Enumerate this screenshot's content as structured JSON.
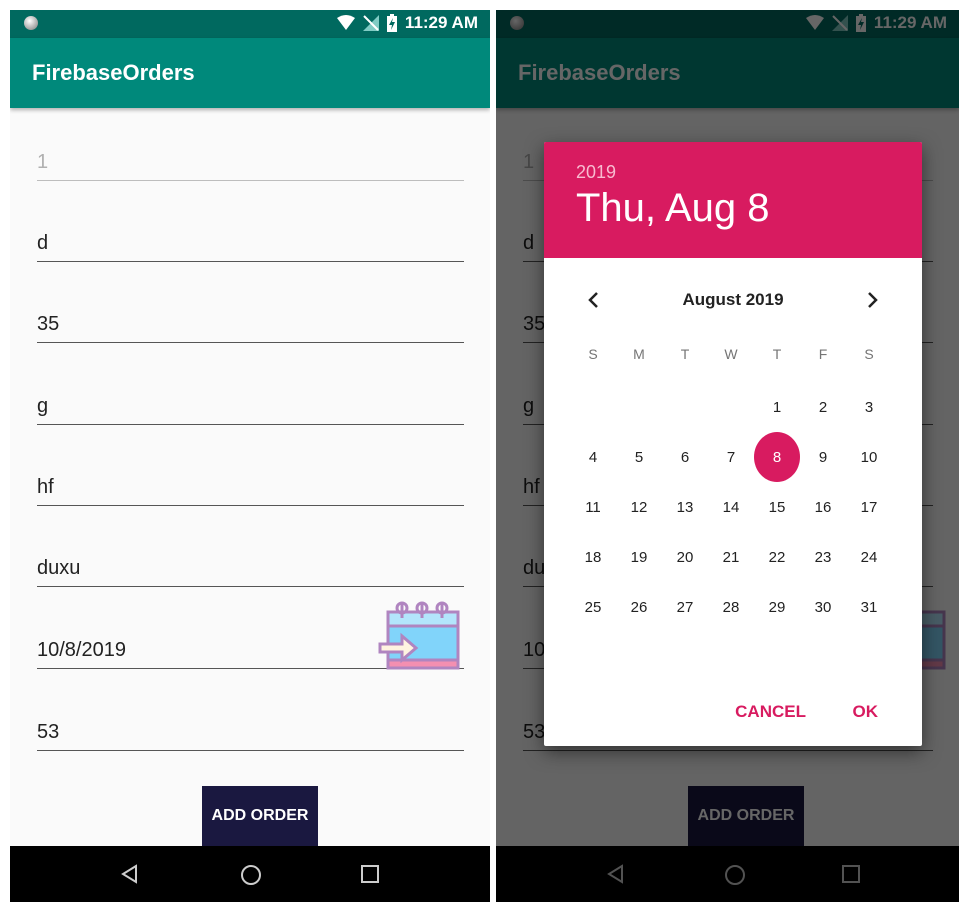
{
  "status_bar": {
    "time": "11:29 AM"
  },
  "app": {
    "title": "FirebaseOrders"
  },
  "form": {
    "fields": [
      {
        "value": "1",
        "disabled": true
      },
      {
        "value": "d"
      },
      {
        "value": "35"
      },
      {
        "value": "g"
      },
      {
        "value": "hf"
      },
      {
        "value": "duxu"
      },
      {
        "value": "10/8/2019"
      },
      {
        "value": "53"
      }
    ],
    "add_button_label": "ADD ORDER"
  },
  "nav_bar": {
    "icons": [
      "back-icon",
      "home-icon",
      "recents-icon"
    ]
  },
  "date_picker": {
    "year": "2019",
    "selected_date_label": "Thu, Aug 8",
    "month_label": "August 2019",
    "weekdays": [
      "S",
      "M",
      "T",
      "W",
      "T",
      "F",
      "S"
    ],
    "first_weekday_index": 4,
    "days_in_month": 31,
    "selected_day": 8,
    "cancel_label": "CANCEL",
    "ok_label": "OK"
  },
  "colors": {
    "primary": "#00897b",
    "primary_dark": "#00695f",
    "accent": "#d81b60",
    "button": "#1a1840"
  }
}
